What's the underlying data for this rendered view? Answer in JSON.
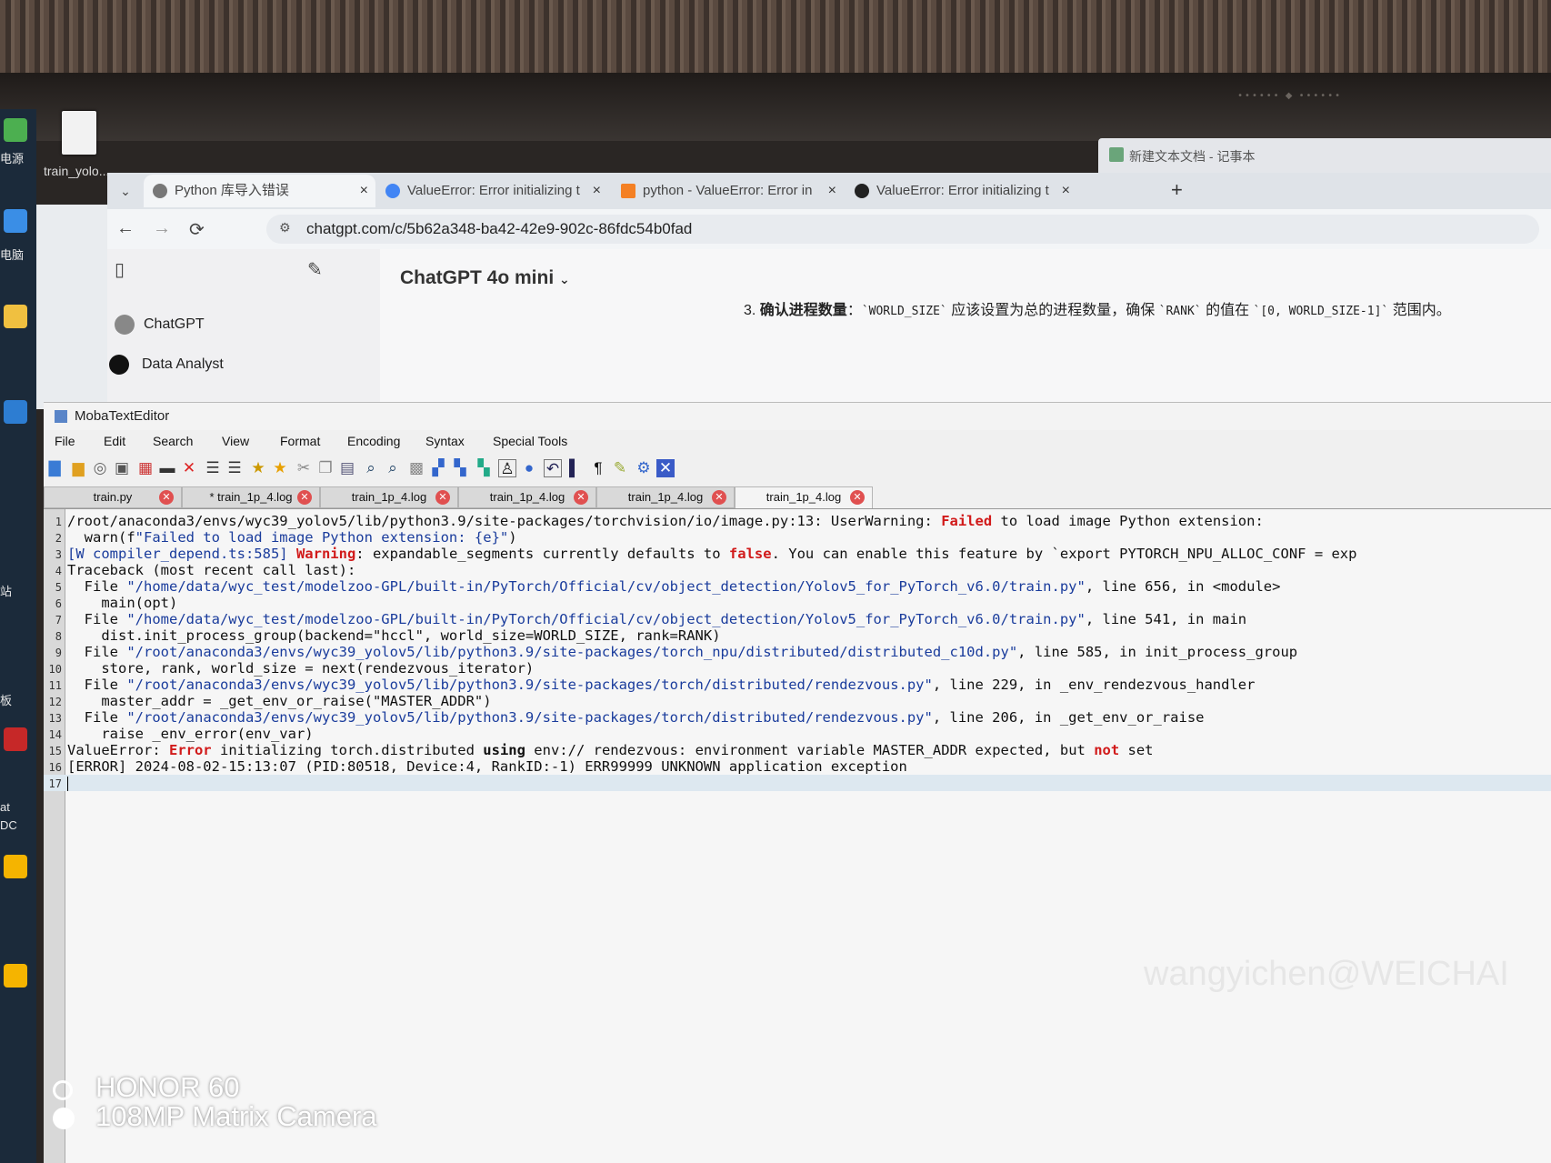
{
  "desktop": {
    "file_label": "train_yolo...",
    "side_labels": [
      "电源",
      "电脑",
      "站",
      "板",
      "at",
      "DC"
    ]
  },
  "notepad": {
    "title": "新建文本文档 - 记事本"
  },
  "browser": {
    "tabs": [
      {
        "label": "Python 库导入错误",
        "active": true
      },
      {
        "label": "ValueError: Error initializing t",
        "active": false
      },
      {
        "label": "python - ValueError: Error in",
        "active": false
      },
      {
        "label": "ValueError: Error initializing t",
        "active": false
      }
    ],
    "close_glyph": "×",
    "new_tab": "+",
    "url": "chatgpt.com/c/5b62a348-ba42-42e9-902c-86fdc54b0fad"
  },
  "chatgpt": {
    "model": "ChatGPT 4o mini",
    "sidebar": [
      "ChatGPT",
      "Data Analyst"
    ],
    "answer": {
      "number": "3.",
      "bold": "确认进程数量",
      "text1": "：",
      "code1": "`WORLD_SIZE`",
      "text2": " 应该设置为总的进程数量，确保 ",
      "code2": "`RANK`",
      "text3": " 的值在 ",
      "code3": "`[0, WORLD_SIZE-1]`",
      "text4": " 范围内。"
    }
  },
  "editor": {
    "title": "MobaTextEditor",
    "menus": [
      "File",
      "Edit",
      "Search",
      "View",
      "Format",
      "Encoding",
      "Syntax",
      "Special Tools"
    ],
    "tabs": [
      {
        "label": "train.py",
        "active": false
      },
      {
        "label": "* train_1p_4.log",
        "active": false
      },
      {
        "label": "train_1p_4.log",
        "active": false
      },
      {
        "label": "train_1p_4.log",
        "active": false
      },
      {
        "label": "train_1p_4.log",
        "active": false
      },
      {
        "label": "train_1p_4.log",
        "active": true
      }
    ],
    "watermark": "wangyichen@WEICHAI",
    "lines": [
      {
        "n": "1",
        "parts": [
          [
            "/root/anaconda3/envs/wyc39_yolov5/lib/python3.9/site-packages/torchvision/io/image.py:13: UserWarning: ",
            ""
          ],
          [
            "Failed",
            "kw"
          ],
          [
            " to load image Python extension:",
            ""
          ]
        ]
      },
      {
        "n": "2",
        "parts": [
          [
            "  warn(f",
            ""
          ],
          [
            "\"Failed to load image Python extension: {e}\"",
            "str"
          ],
          [
            ")",
            ""
          ]
        ]
      },
      {
        "n": "3",
        "parts": [
          [
            "[W compiler_depend.ts:585] ",
            "path"
          ],
          [
            "Warning",
            "kw"
          ],
          [
            ": expandable_segments currently defaults to ",
            ""
          ],
          [
            "false",
            "kw"
          ],
          [
            ". You can enable this feature by `export PYTORCH_NPU_ALLOC_CONF = exp",
            ""
          ]
        ]
      },
      {
        "n": "4",
        "parts": [
          [
            "Traceback (most recent call last):",
            ""
          ]
        ]
      },
      {
        "n": "5",
        "parts": [
          [
            "  File ",
            ""
          ],
          [
            "\"/home/data/wyc_test/modelzoo-GPL/built-in/PyTorch/Official/cv/object_detection/Yolov5_for_PyTorch_v6.0/train.py\"",
            "str"
          ],
          [
            ", line 656, in <module>",
            ""
          ]
        ]
      },
      {
        "n": "6",
        "parts": [
          [
            "    main(opt)",
            ""
          ]
        ]
      },
      {
        "n": "7",
        "parts": [
          [
            "  File ",
            ""
          ],
          [
            "\"/home/data/wyc_test/modelzoo-GPL/built-in/PyTorch/Official/cv/object_detection/Yolov5_for_PyTorch_v6.0/train.py\"",
            "str"
          ],
          [
            ", line 541, in main",
            ""
          ]
        ]
      },
      {
        "n": "8",
        "parts": [
          [
            "    dist.init_process_group(backend=\"hccl\", world_size=WORLD_SIZE, rank=RANK)",
            ""
          ]
        ]
      },
      {
        "n": "9",
        "parts": [
          [
            "  File ",
            ""
          ],
          [
            "\"/root/anaconda3/envs/wyc39_yolov5/lib/python3.9/site-packages/torch_npu/distributed/distributed_c10d.py\"",
            "str"
          ],
          [
            ", line 585, in init_process_group",
            ""
          ]
        ]
      },
      {
        "n": "10",
        "parts": [
          [
            "    store, rank, world_size = next(rendezvous_iterator)",
            ""
          ]
        ]
      },
      {
        "n": "11",
        "parts": [
          [
            "  File ",
            ""
          ],
          [
            "\"/root/anaconda3/envs/wyc39_yolov5/lib/python3.9/site-packages/torch/distributed/rendezvous.py\"",
            "str"
          ],
          [
            ", line 229, in _env_rendezvous_handler",
            ""
          ]
        ]
      },
      {
        "n": "12",
        "parts": [
          [
            "    master_addr = _get_env_or_raise(\"MASTER_ADDR\")",
            ""
          ]
        ]
      },
      {
        "n": "13",
        "parts": [
          [
            "  File ",
            ""
          ],
          [
            "\"/root/anaconda3/envs/wyc39_yolov5/lib/python3.9/site-packages/torch/distributed/rendezvous.py\"",
            "str"
          ],
          [
            ", line 206, in _get_env_or_raise",
            ""
          ]
        ]
      },
      {
        "n": "14",
        "parts": [
          [
            "    raise _env_error(env_var)",
            ""
          ]
        ]
      },
      {
        "n": "15",
        "parts": [
          [
            "ValueError: ",
            ""
          ],
          [
            "Error",
            "kw"
          ],
          [
            " initializing torch.distributed ",
            ""
          ],
          [
            "using",
            "b"
          ],
          [
            " env:// rendezvous: environment variable MASTER_ADDR expected, but ",
            ""
          ],
          [
            "not",
            "kw"
          ],
          [
            " set",
            ""
          ]
        ]
      },
      {
        "n": "16",
        "parts": [
          [
            "[ERROR] 2024-08-02-15:13:07 (PID:80518, Device:4, RankID:-1) ERR99999 UNKNOWN application exception",
            ""
          ]
        ]
      },
      {
        "n": "17",
        "parts": []
      }
    ]
  },
  "camera": {
    "line1": "HONOR 60",
    "line2": "108MP Matrix Camera"
  }
}
